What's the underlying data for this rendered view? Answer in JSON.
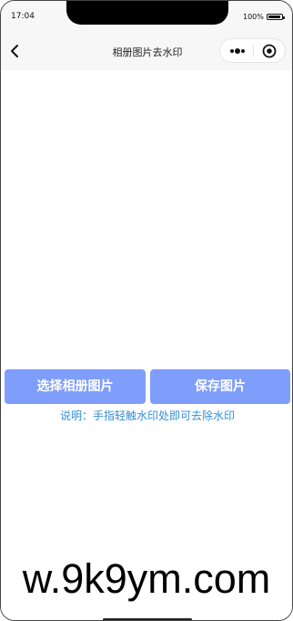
{
  "status_bar": {
    "time": "17:04",
    "battery_text": "100%"
  },
  "nav": {
    "title": "相册图片去水印",
    "back_icon": "chevron-left-icon",
    "more_icon": "more-dots-icon",
    "close_icon": "target-close-icon"
  },
  "actions": {
    "choose_label": "选择相册图片",
    "save_label": "保存图片"
  },
  "hint_text": "说明：手指轻触水印处即可去除水印",
  "watermark_text": "w.9k9ym.com",
  "colors": {
    "button_bg": "#7f9efc",
    "hint_color": "#3490d9",
    "nav_bg": "#f7f7f7"
  }
}
